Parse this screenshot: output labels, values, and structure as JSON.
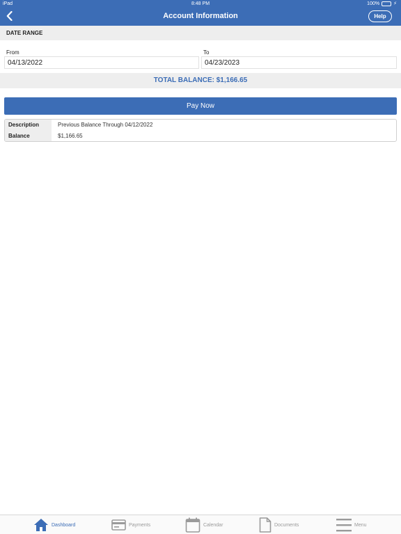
{
  "status": {
    "device": "iPad",
    "time": "8:48 PM",
    "battery": "100%"
  },
  "header": {
    "title": "Account Information",
    "help_label": "Help"
  },
  "date_range": {
    "heading": "DATE RANGE",
    "from_label": "From",
    "from_value": "04/13/2022",
    "to_label": "To",
    "to_value": "04/23/2023"
  },
  "total_balance": "TOTAL BALANCE: $1,166.65",
  "pay_now_label": "Pay Now",
  "details": [
    {
      "key": "Description",
      "value": "Previous Balance Through 04/12/2022"
    },
    {
      "key": "Balance",
      "value": "$1,166.65"
    }
  ],
  "tabs": [
    {
      "label": "Dashboard",
      "icon": "home-icon",
      "active": true
    },
    {
      "label": "Payments",
      "icon": "credit-card-icon",
      "active": false
    },
    {
      "label": "Calendar",
      "icon": "calendar-icon",
      "active": false
    },
    {
      "label": "Documents",
      "icon": "document-icon",
      "active": false
    },
    {
      "label": "Menu",
      "icon": "menu-icon",
      "active": false
    }
  ],
  "colors": {
    "brand": "#3c6db6",
    "inactive": "#9a9a9a",
    "battery": "#5fd35b"
  }
}
